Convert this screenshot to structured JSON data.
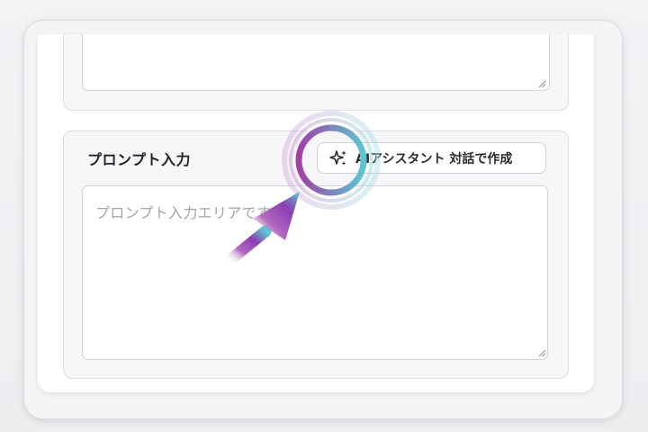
{
  "prompt_section": {
    "label": "プロンプト入力",
    "ai_button_label": "AIアシスタント 対話で作成",
    "ai_button_icon": "sparkle-icon",
    "textarea_placeholder": "プロンプト入力エリアです"
  },
  "top_section": {
    "textarea_value": ""
  },
  "highlight": {
    "ring_colors": [
      "#a23fa6",
      "#5bc6d2"
    ],
    "arrow_colors": [
      "#8b3fb0",
      "#5bc6d2"
    ]
  }
}
